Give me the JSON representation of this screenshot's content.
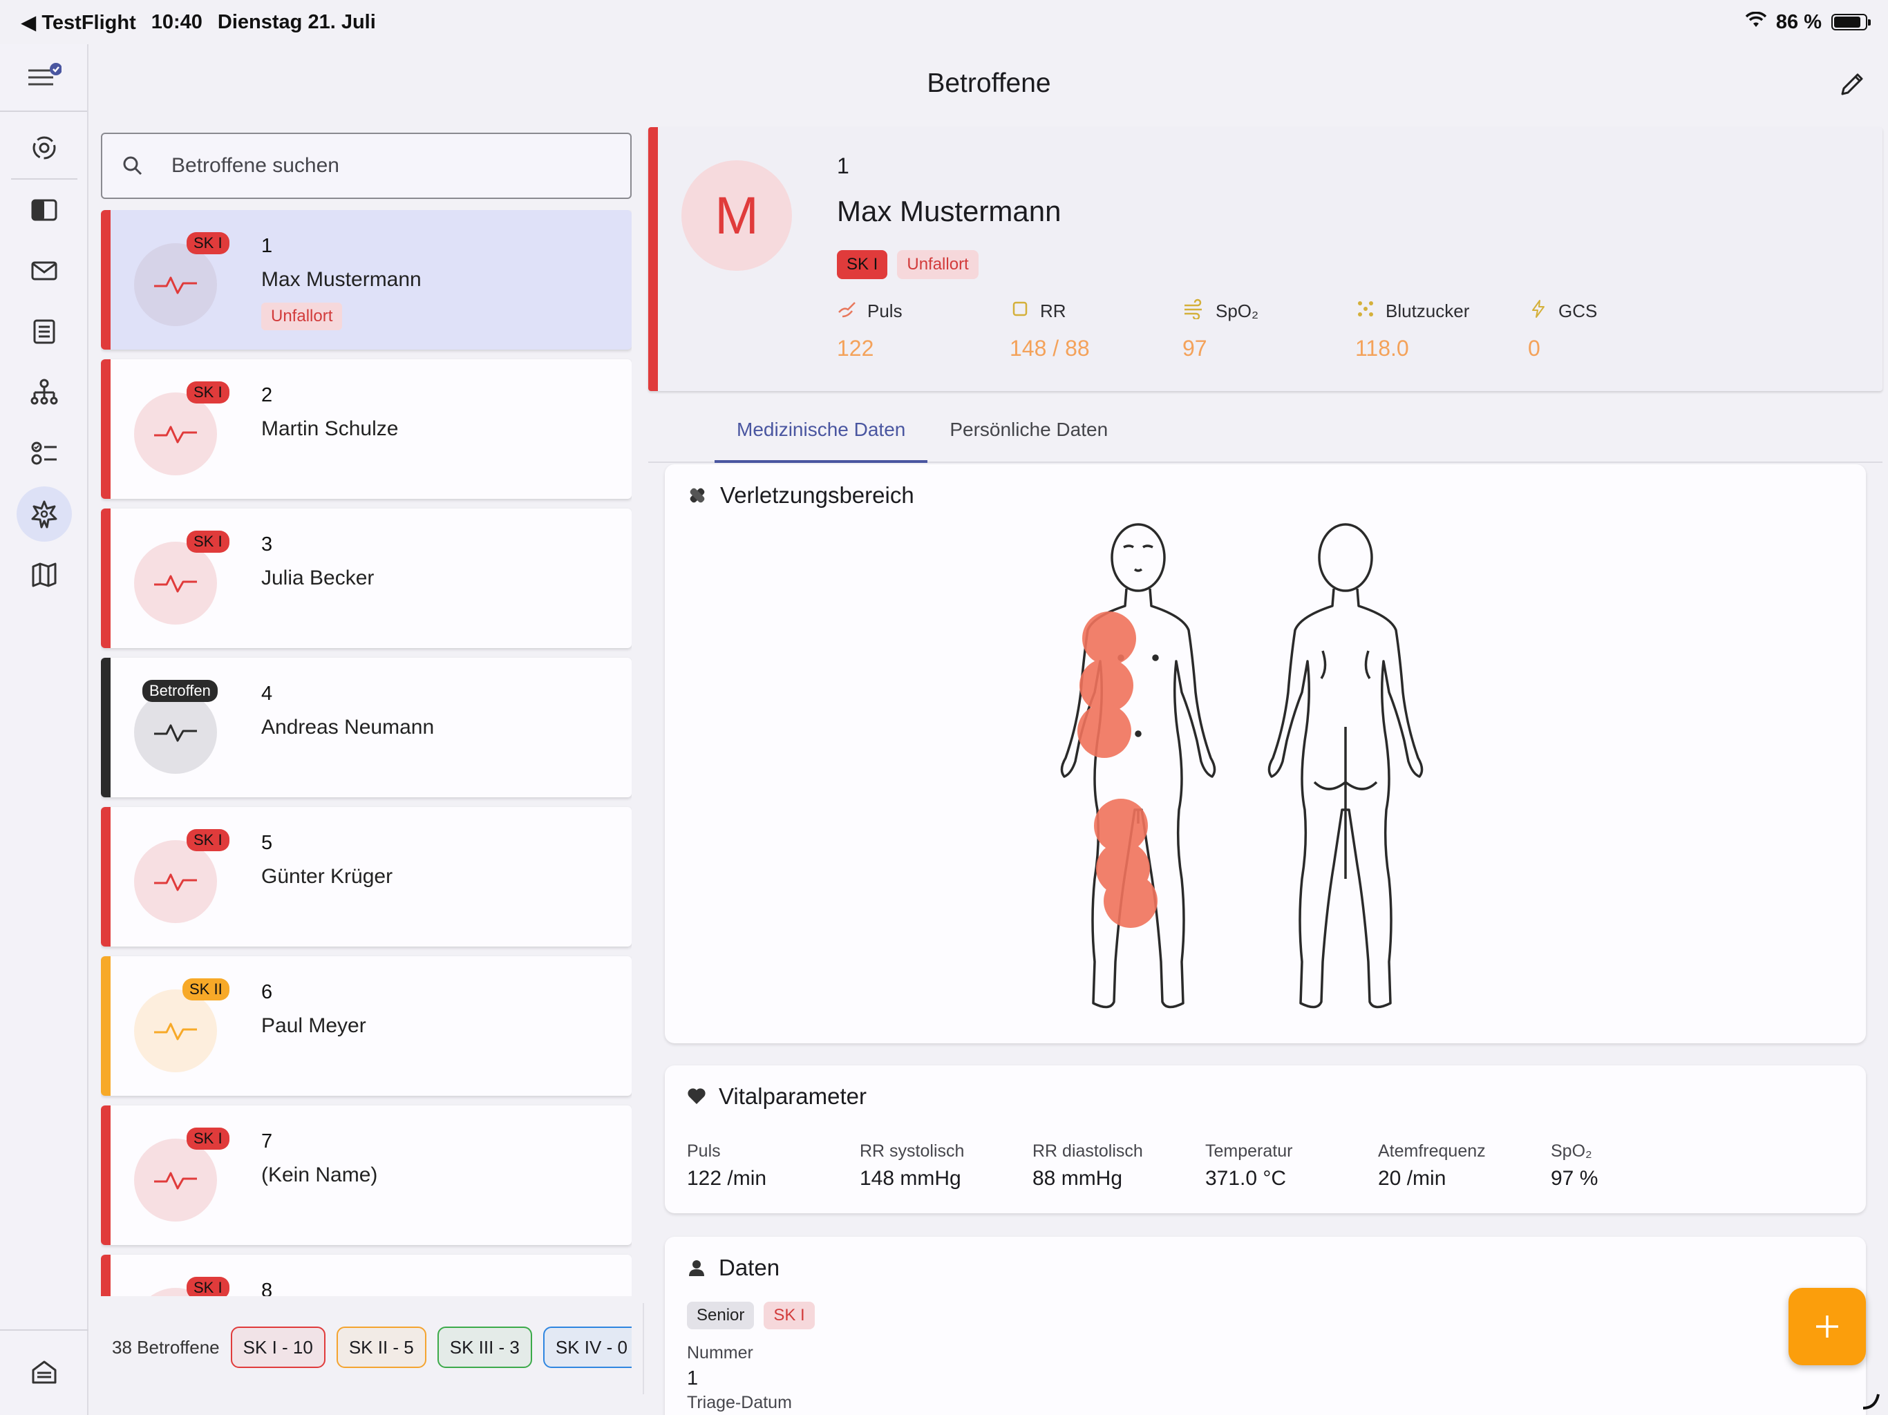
{
  "status": {
    "back_app": "TestFlight",
    "time": "10:40",
    "date": "Dienstag 21. Juli",
    "battery": "86 %"
  },
  "header": {
    "title": "Betroffene"
  },
  "search": {
    "placeholder": "Betroffene suchen"
  },
  "patients": [
    {
      "num": "1",
      "name": "Max Mustermann",
      "badge": "SK I",
      "level": "sk1",
      "chip": "Unfallort",
      "selected": true
    },
    {
      "num": "2",
      "name": "Martin Schulze",
      "badge": "SK I",
      "level": "sk1"
    },
    {
      "num": "3",
      "name": "Julia Becker",
      "badge": "SK I",
      "level": "sk1"
    },
    {
      "num": "4",
      "name": "Andreas  Neumann",
      "badge": "Betroffen",
      "level": "bet"
    },
    {
      "num": "5",
      "name": "Günter Krüger",
      "badge": "SK I",
      "level": "sk1"
    },
    {
      "num": "6",
      "name": "Paul Meyer",
      "badge": "SK II",
      "level": "sk2"
    },
    {
      "num": "7",
      "name": "(Kein Name)",
      "badge": "SK I",
      "level": "sk1"
    },
    {
      "num": "8",
      "name": "",
      "badge": "SK I",
      "level": "sk1"
    }
  ],
  "footer": {
    "count": "38 Betroffene",
    "pills": [
      {
        "label": "SK I - 10",
        "color": "#e03b3b"
      },
      {
        "label": "SK II - 5",
        "color": "#f4a430"
      },
      {
        "label": "SK III - 3",
        "color": "#3caa4a"
      },
      {
        "label": "SK IV - 0",
        "color": "#2f86e0"
      }
    ]
  },
  "colors": {
    "sk1": "#e03b3b",
    "sk2": "#f7a928",
    "bet": "#2b2b2b",
    "accent": "#4a56a0",
    "vital_value": "#f4a25a",
    "fab": "#fb9e0c"
  },
  "detail": {
    "avatar_letter": "M",
    "num": "1",
    "name": "Max Mustermann",
    "tags": [
      "SK I",
      "Unfallort"
    ],
    "vitals": [
      {
        "label": "Puls",
        "value": "122",
        "icon": "pulse-hand-icon"
      },
      {
        "label": "RR",
        "value": "148 / 88",
        "icon": "square-icon"
      },
      {
        "label": "SpO₂",
        "value": "97",
        "icon": "wind-icon"
      },
      {
        "label": "Blutzucker",
        "value": "118.0",
        "icon": "dots-icon"
      },
      {
        "label": "GCS",
        "value": "0",
        "icon": "bolt-icon"
      }
    ]
  },
  "tabs": [
    "Medizinische Daten",
    "Persönliche Daten"
  ],
  "injury": {
    "title": "Verletzungsbereich"
  },
  "vitalparameter": {
    "title": "Vitalparameter",
    "items": [
      {
        "k": "Puls",
        "v": "122 /min"
      },
      {
        "k": "RR systolisch",
        "v": "148 mmHg"
      },
      {
        "k": "RR diastolisch",
        "v": "88 mmHg"
      },
      {
        "k": "Temperatur",
        "v": "371.0 °C"
      },
      {
        "k": "Atemfrequenz",
        "v": "20 /min"
      },
      {
        "k": "SpO₂",
        "v": "97 %"
      }
    ]
  },
  "daten": {
    "title": "Daten",
    "tags": [
      "Senior",
      "SK I"
    ],
    "fields": [
      {
        "k": "Nummer",
        "v": "1"
      },
      {
        "k": "Triage-Datum",
        "v": ""
      }
    ]
  }
}
